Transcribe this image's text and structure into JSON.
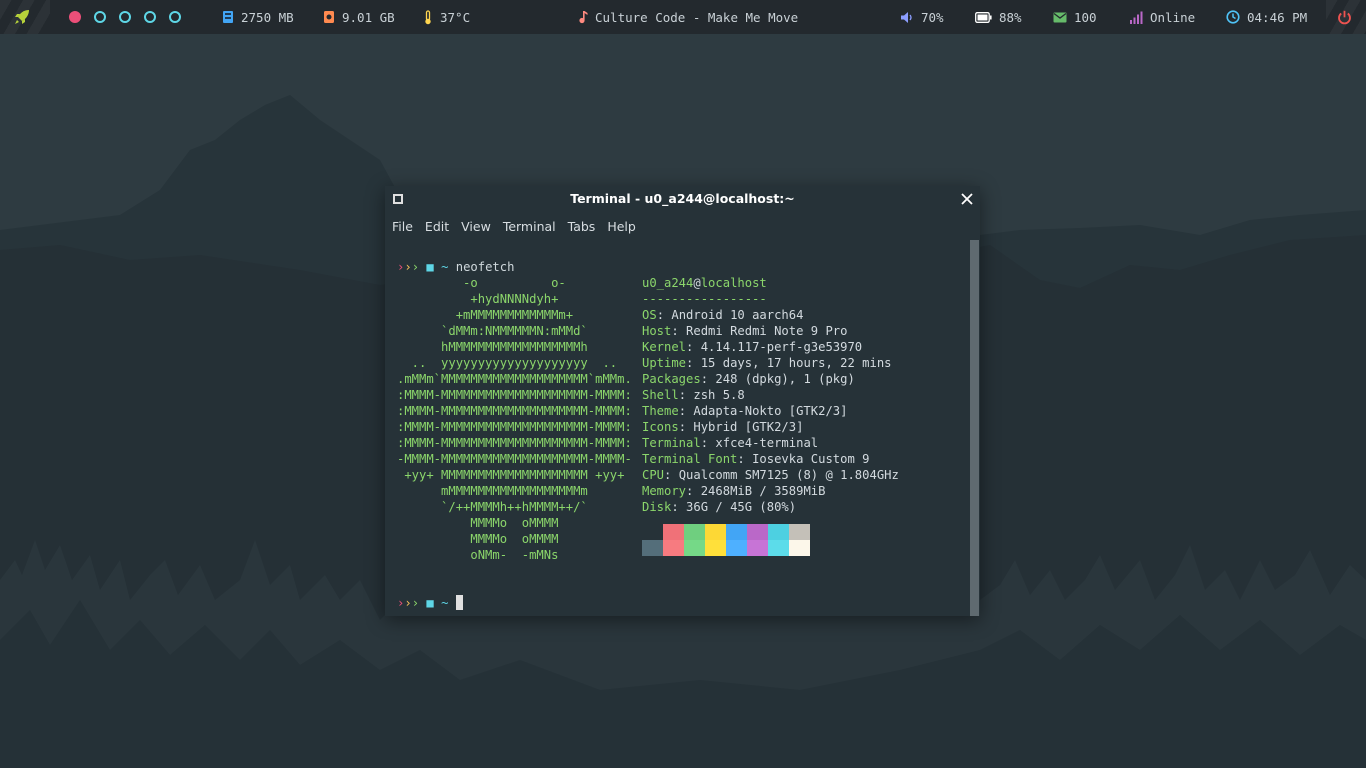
{
  "topbar": {
    "memory": "2750 MB",
    "disk": "9.01 GB",
    "temperature": "37°C",
    "now_playing": "Culture Code - Make Me Move",
    "volume": "70%",
    "battery": "88%",
    "mail": "100",
    "network": "Online",
    "clock": "04:46 PM",
    "workspaces": [
      "active",
      "empty",
      "empty",
      "empty",
      "empty"
    ],
    "colors": {
      "rocket": "#b7d33a",
      "memory": "#42a5f5",
      "disk": "#ff8a50",
      "temperature": "#ffd54f",
      "music": "#ff8a80",
      "volume": "#8c9eff",
      "battery": "#ffffff",
      "mail": "#66bb6a",
      "network": "#ba68c8",
      "clock": "#4fc3f7",
      "power": "#ef5350",
      "workspace_active": "#ec4f79",
      "workspace_empty": "#5ed6e6"
    },
    "icons": [
      "rocket-icon",
      "memory-icon",
      "disk-icon",
      "thermometer-icon",
      "music-note-icon",
      "volume-icon",
      "battery-icon",
      "mail-icon",
      "signal-icon",
      "clock-icon",
      "power-icon"
    ]
  },
  "window": {
    "title": "Terminal - u0_a244@localhost:~",
    "menu": [
      "File",
      "Edit",
      "View",
      "Terminal",
      "Tabs",
      "Help"
    ]
  },
  "terminal": {
    "prompt_arrows": "›››",
    "prompt_dir": "~",
    "command": "neofetch",
    "logo": [
      "         -o          o-",
      "          +hydNNNNdyh+",
      "        +mMMMMMMMMMMMMm+",
      "      `dMMm:NMMMMMMN:mMMd`",
      "      hMMMMMMMMMMMMMMMMMMh",
      "  ..  yyyyyyyyyyyyyyyyyyyy  ..",
      ".mMMm`MMMMMMMMMMMMMMMMMMMM`mMMm.",
      ":MMMM-MMMMMMMMMMMMMMMMMMMM-MMMM:",
      ":MMMM-MMMMMMMMMMMMMMMMMMMM-MMMM:",
      ":MMMM-MMMMMMMMMMMMMMMMMMMM-MMMM:",
      ":MMMM-MMMMMMMMMMMMMMMMMMMM-MMMM:",
      "-MMMM-MMMMMMMMMMMMMMMMMMMM-MMMM-",
      " +yy+ MMMMMMMMMMMMMMMMMMMM +yy+",
      "      mMMMMMMMMMMMMMMMMMMm",
      "      `/++MMMMh++hMMMM++/`",
      "          MMMMo  oMMMM",
      "          MMMMo  oMMMM",
      "          oNMm-  -mMNs"
    ],
    "user": "u0_a244",
    "at": "@",
    "host": "localhost",
    "separator": "-----------------",
    "info": [
      {
        "key": "OS",
        "value": "Android 10 aarch64"
      },
      {
        "key": "Host",
        "value": "Redmi Redmi Note 9 Pro"
      },
      {
        "key": "Kernel",
        "value": "4.14.117-perf-g3e53970"
      },
      {
        "key": "Uptime",
        "value": "15 days, 17 hours, 22 mins"
      },
      {
        "key": "Packages",
        "value": "248 (dpkg), 1 (pkg)"
      },
      {
        "key": "Shell",
        "value": "zsh 5.8"
      },
      {
        "key": "Theme",
        "value": "Adapta-Nokto [GTK2/3]"
      },
      {
        "key": "Icons",
        "value": "Hybrid [GTK2/3]"
      },
      {
        "key": "Terminal",
        "value": "xfce4-terminal"
      },
      {
        "key": "Terminal Font",
        "value": "Iosevka Custom 9"
      },
      {
        "key": "CPU",
        "value": "Qualcomm SM7125 (8) @ 1.804GHz"
      },
      {
        "key": "Memory",
        "value": "2468MiB / 3589MiB"
      },
      {
        "key": "Disk",
        "value": "36G / 45G (80%)"
      }
    ],
    "key_suffix": ": ",
    "palette_top": [
      "#263238",
      "#f07178",
      "#6fcf7f",
      "#fdd835",
      "#42a5f5",
      "#ba68c8",
      "#4dd0e1",
      "#c4c0b8"
    ],
    "palette_bottom": [
      "#546e7a",
      "#f77b80",
      "#75d987",
      "#ffe03a",
      "#4eb0ff",
      "#c774d6",
      "#5cdcea",
      "#fcf7ea"
    ]
  }
}
